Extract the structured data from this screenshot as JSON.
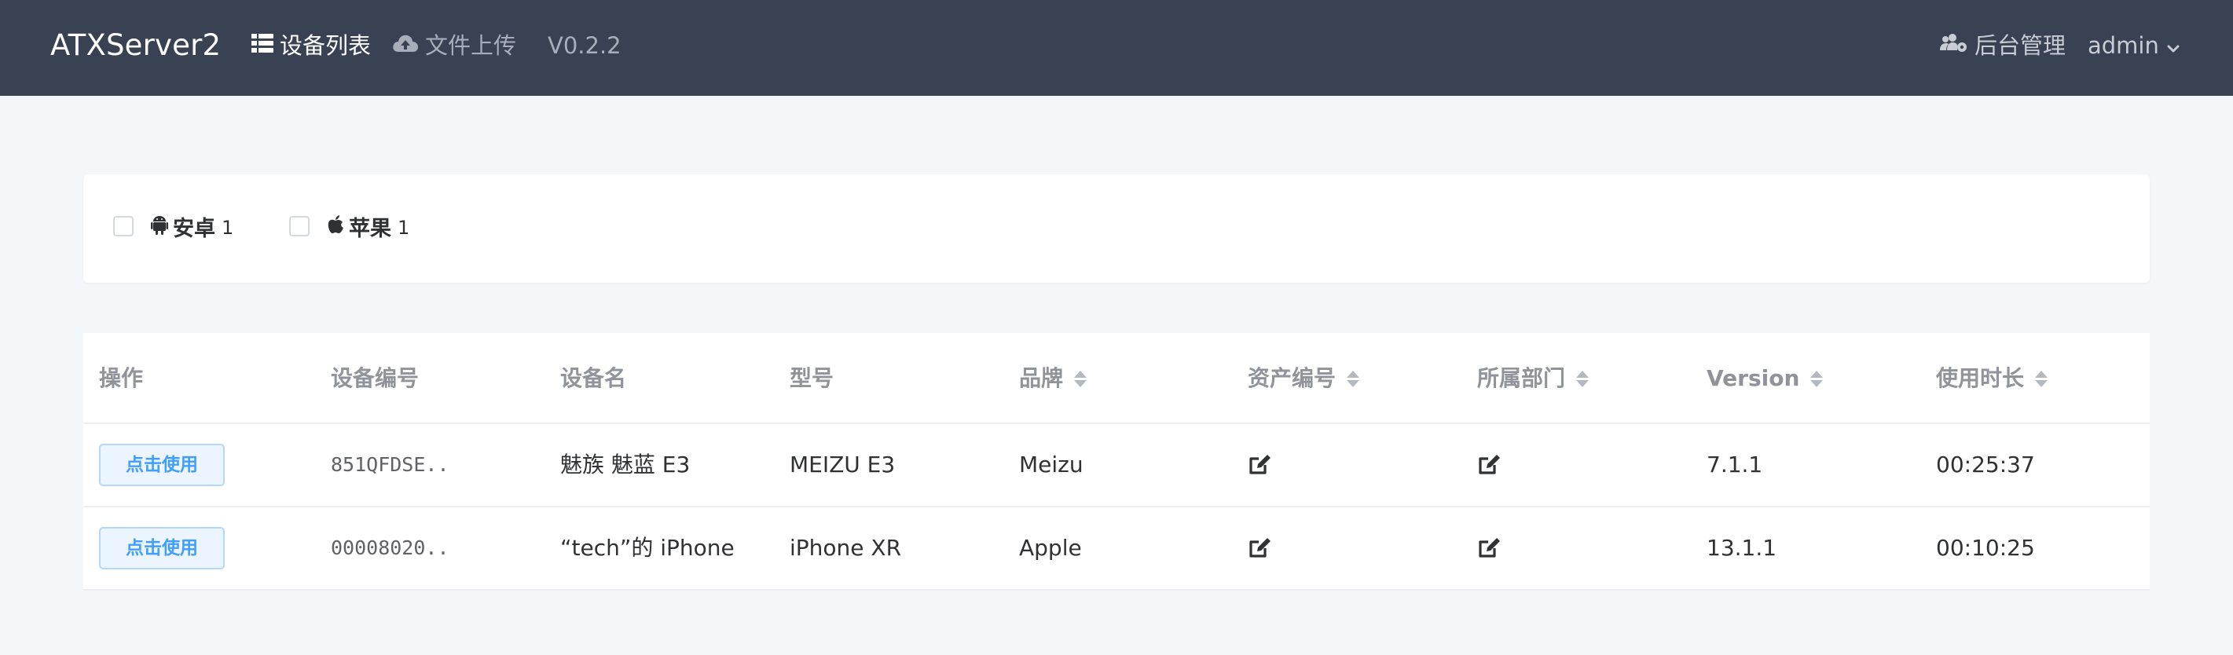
{
  "navbar": {
    "brand": "ATXServer2",
    "devices_label": "设备列表",
    "upload_label": "文件上传",
    "version": "V0.2.2",
    "admin_label": "后台管理",
    "user_label": "admin",
    "colors": {
      "background": "#384252",
      "active": "#ffffff",
      "inactive": "#a7aeb9"
    }
  },
  "filters": [
    {
      "label": "安卓",
      "count": "1",
      "icon": "android-icon",
      "checked": false
    },
    {
      "label": "苹果",
      "count": "1",
      "icon": "apple-icon",
      "checked": false
    }
  ],
  "table": {
    "columns": [
      {
        "label": "操作",
        "sortable": false
      },
      {
        "label": "设备编号",
        "sortable": false
      },
      {
        "label": "设备名",
        "sortable": false
      },
      {
        "label": "型号",
        "sortable": false
      },
      {
        "label": "品牌",
        "sortable": true
      },
      {
        "label": "资产编号",
        "sortable": true
      },
      {
        "label": "所属部门",
        "sortable": true
      },
      {
        "label": "Version",
        "sortable": true
      },
      {
        "label": "使用时长",
        "sortable": true
      }
    ],
    "rows": [
      {
        "action_label": "点击使用",
        "serial": "851QFDSE..",
        "name": "魅族 魅蓝 E3",
        "model": "MEIZU E3",
        "brand": "Meizu",
        "asset_icon": "edit-icon",
        "dept_icon": "edit-icon",
        "version": "7.1.1",
        "duration": "00:25:37"
      },
      {
        "action_label": "点击使用",
        "serial": "00008020..",
        "name": "“tech”的 iPhone",
        "model": "iPhone XR",
        "brand": "Apple",
        "asset_icon": "edit-icon",
        "dept_icon": "edit-icon",
        "version": "13.1.1",
        "duration": "00:10:25"
      }
    ],
    "colors": {
      "button_bg": "#ecf5ff",
      "button_border": "#b3d8ff",
      "button_text": "#409eff",
      "header_text": "#909399"
    }
  }
}
